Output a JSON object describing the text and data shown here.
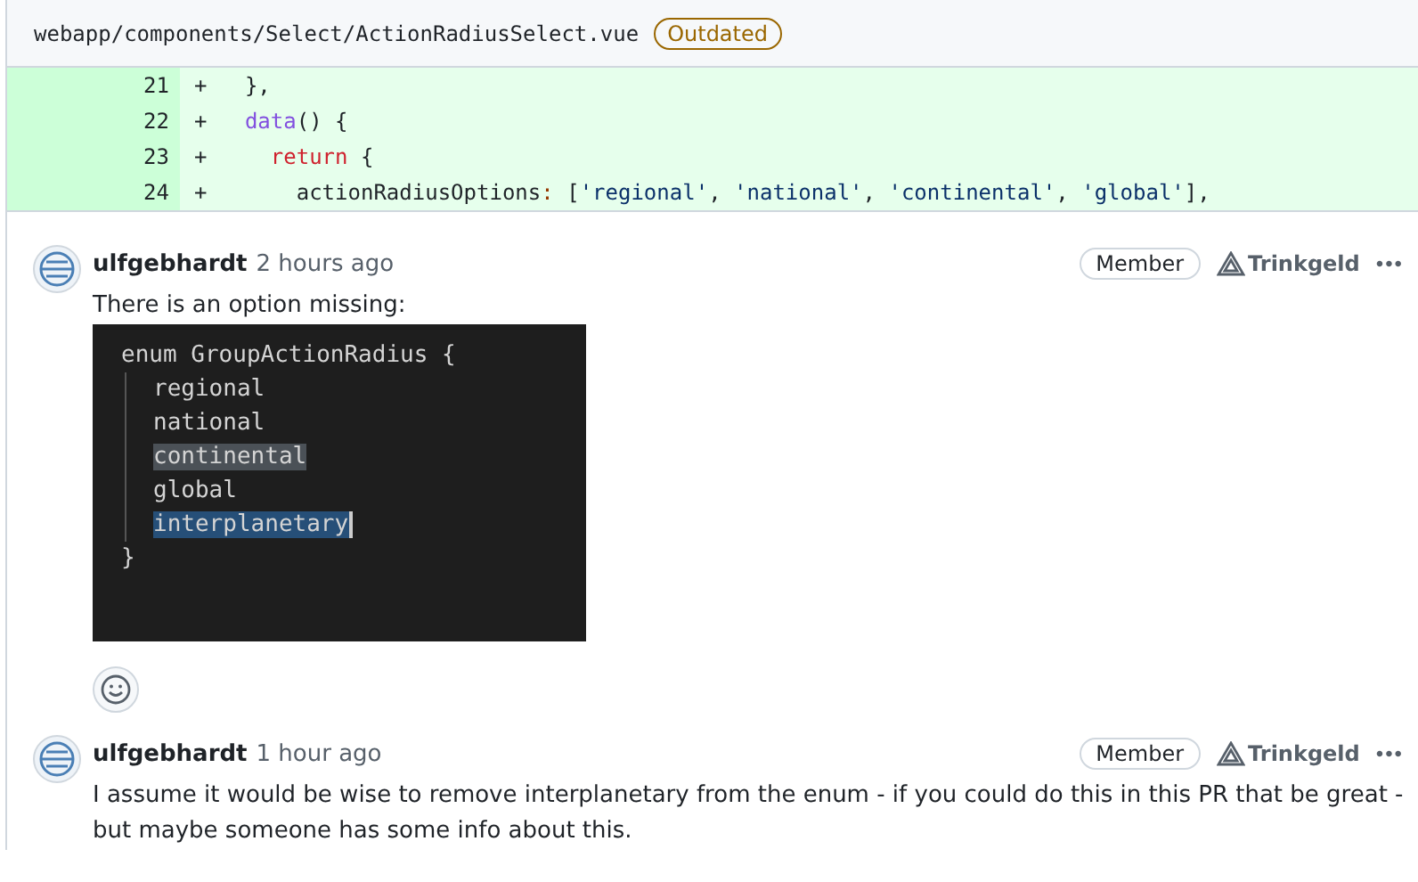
{
  "file_header": {
    "path": "webapp/components/Select/ActionRadiusSelect.vue",
    "badge": "Outdated"
  },
  "diff_lines": [
    {
      "number": "21",
      "sign": "+",
      "tokens": [
        {
          "kind": "plain",
          "text": "  },"
        }
      ]
    },
    {
      "number": "22",
      "sign": "+",
      "tokens": [
        {
          "kind": "function",
          "text": "  data"
        },
        {
          "kind": "plain",
          "text": "() {"
        }
      ]
    },
    {
      "number": "23",
      "sign": "+",
      "tokens": [
        {
          "kind": "keyword",
          "text": "    return"
        },
        {
          "kind": "plain",
          "text": " {"
        }
      ]
    },
    {
      "number": "24",
      "sign": "+",
      "tokens": [
        {
          "kind": "plain",
          "text": "      actionRadiusOptions"
        },
        {
          "kind": "punct",
          "text": ":"
        },
        {
          "kind": "plain",
          "text": " ["
        },
        {
          "kind": "string",
          "text": "'regional'"
        },
        {
          "kind": "plain",
          "text": ", "
        },
        {
          "kind": "string",
          "text": "'national'"
        },
        {
          "kind": "plain",
          "text": ", "
        },
        {
          "kind": "string",
          "text": "'continental'"
        },
        {
          "kind": "plain",
          "text": ", "
        },
        {
          "kind": "string",
          "text": "'global'"
        },
        {
          "kind": "plain",
          "text": "],"
        }
      ]
    }
  ],
  "comments": [
    {
      "author": "ulfgebhardt",
      "time": "2 hours ago",
      "role": "Member",
      "tip": "Trinkgeld",
      "menu": "•••",
      "body": "There is an option missing:",
      "screenshot": {
        "open": "enum GroupActionRadius {",
        "children": [
          {
            "text": "regional",
            "kind": "plain"
          },
          {
            "text": "national",
            "kind": "plain"
          },
          {
            "text": "continental",
            "kind": "match"
          },
          {
            "text": "global",
            "kind": "plain"
          },
          {
            "text": "interplanetary",
            "kind": "selection"
          }
        ],
        "close": "}"
      },
      "reaction_button": true
    },
    {
      "author": "ulfgebhardt",
      "time": "1 hour ago",
      "role": "Member",
      "tip": "Trinkgeld",
      "menu": "•••",
      "body": "I assume it would be wise to remove interplanetary from the enum - if you could do this in this PR that be great - but maybe someone has some info about this."
    }
  ]
}
